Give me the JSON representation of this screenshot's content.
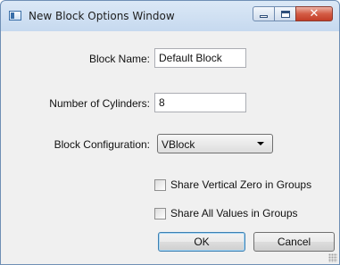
{
  "window": {
    "title": "New Block Options Window",
    "icon": "window-app-icon",
    "close_glyph": "✕"
  },
  "form": {
    "block_name": {
      "label": "Block Name:",
      "value": "Default Block"
    },
    "cylinders": {
      "label": "Number of Cylinders:",
      "value": "8"
    },
    "configuration": {
      "label": "Block Configuration:",
      "selected": "VBlock"
    },
    "share_vertical_zero": {
      "label": "Share Vertical Zero in Groups",
      "checked": false
    },
    "share_all_values": {
      "label": "Share All Values in Groups",
      "checked": false
    }
  },
  "buttons": {
    "ok": "OK",
    "cancel": "Cancel"
  },
  "colors": {
    "close_button": "#c9452f",
    "default_button_border": "#3c7fb1"
  }
}
